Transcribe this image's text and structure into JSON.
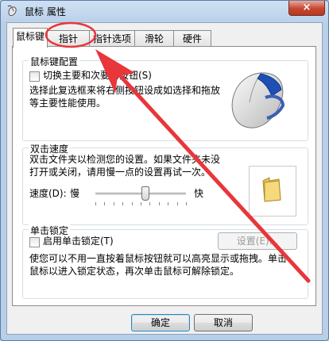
{
  "window": {
    "title": "鼠标 属性",
    "close_label": "×"
  },
  "tabs": [
    {
      "label": "鼠标键"
    },
    {
      "label": "指针"
    },
    {
      "label": "指针选项"
    },
    {
      "label": "滑轮"
    },
    {
      "label": "硬件"
    }
  ],
  "button_config": {
    "group_label": "鼠标键配置",
    "checkbox_label": "切换主要和次要的按钮(S)",
    "checked": false,
    "description_line1": "选择此复选框来将右侧按钮设成如选择和拖放",
    "description_line2": "等主要性能使用。"
  },
  "double_click": {
    "group_label": "双击速度",
    "description_line1": "双击文件夹以检测您的设置。如果文件夹未没",
    "description_line2": "打开或关闭，请用慢一点的设置再试一次。",
    "speed_label": "速度(D):",
    "slow_label": "慢",
    "fast_label": "快",
    "speed_level_fraction": 0.55
  },
  "click_lock": {
    "group_label": "单击锁定",
    "checkbox_label": "启用单击锁定(T)",
    "checked": false,
    "settings_button": "设置(E)...",
    "description_line1": "使您可以不用一直按着鼠标按钮就可以高亮显示或拖拽。单击",
    "description_line2": "鼠标以进入锁定状态，再次单击鼠标可解除锁定。"
  },
  "footer": {
    "ok_button": "确定",
    "cancel_button": "取消"
  },
  "colors": {
    "annotation_red": "#e8363a",
    "window_frame": "#b8cfe8",
    "close_red": "#c7462f"
  }
}
